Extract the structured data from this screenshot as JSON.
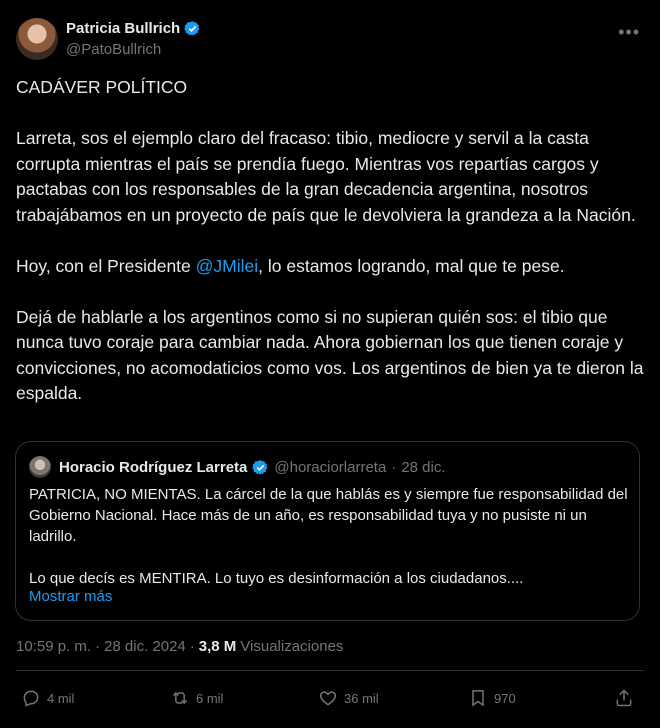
{
  "author": {
    "name": "Patricia Bullrich",
    "handle": "@PatoBullrich"
  },
  "tweet": {
    "title_line": "CADÁVER POLÍTICO",
    "paragraph1": "Larreta, sos el ejemplo claro del fracaso: tibio, mediocre y servil a la casta corrupta mientras el país se prendía fuego. Mientras vos repartías cargos y pactabas con los responsables de la gran decadencia argentina, nosotros trabajábamos en un proyecto de país que le devolviera la grandeza a la Nación.",
    "p2_before": "Hoy, con el Presidente ",
    "p2_mention": "@JMilei",
    "p2_after": ", lo estamos logrando, mal que te pese.",
    "paragraph3": "Dejá de hablarle a los argentinos como si no supieran quién sos: el tibio que nunca tuvo coraje para cambiar nada. Ahora gobiernan los que tienen coraje y convicciones, no acomodaticios como vos. Los argentinos de bien ya te dieron la espalda."
  },
  "quoted": {
    "name": "Horacio Rodríguez Larreta",
    "handle": "@horaciorlarreta",
    "separator": "·",
    "date": "28 dic.",
    "body": "PATRICIA, NO MIENTAS. La cárcel de la que hablás es y siempre fue responsabilidad del Gobierno Nacional. Hace más de un año, es responsabilidad tuya y no pusiste ni un ladrillo.\n\nLo que decís es MENTIRA. Lo tuyo es desinformación a los ciudadanos....",
    "show_more": "Mostrar más"
  },
  "meta": {
    "time": "10:59 p. m.",
    "sep1": "·",
    "date": "28 dic. 2024",
    "sep2": "·",
    "views_count": "3,8 M",
    "views_label": "Visualizaciones"
  },
  "actions": {
    "replies": "4 mil",
    "reposts": "6 mil",
    "likes": "36 mil",
    "bookmarks": "970"
  },
  "colors": {
    "background": "#000000",
    "text": "#e7e9ea",
    "muted": "#71767b",
    "accent": "#1d9bf0",
    "border": "#2f3336"
  },
  "icons": [
    "verified-badge-icon",
    "more-icon",
    "reply-icon",
    "repost-icon",
    "like-icon",
    "bookmark-icon",
    "share-icon"
  ]
}
